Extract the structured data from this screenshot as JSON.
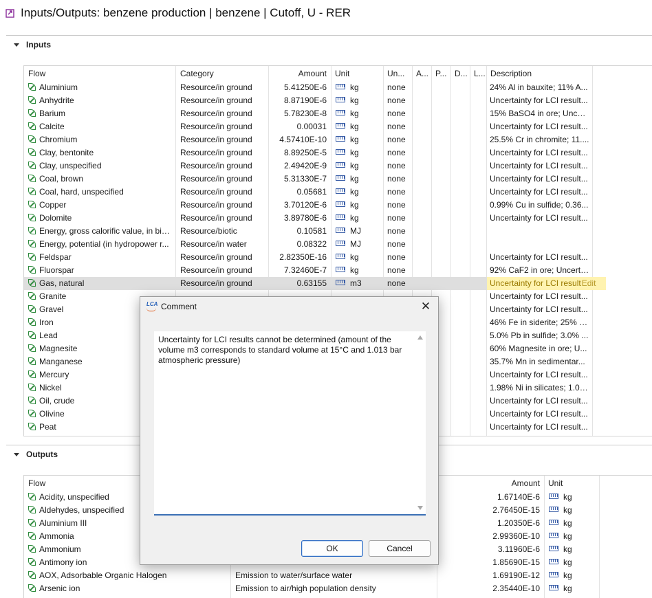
{
  "window": {
    "title": "Inputs/Outputs: benzene production | benzene | Cutoff, U - RER"
  },
  "inputs": {
    "section_label": "Inputs",
    "columns": {
      "flow": "Flow",
      "category": "Category",
      "amount": "Amount",
      "unit": "Unit",
      "uncertainty": "Un...",
      "avoided": "A...",
      "provider": "P...",
      "dq": "D...",
      "location": "L...",
      "description": "Description"
    },
    "rows": [
      {
        "flow": "Aluminium",
        "category": "Resource/in ground",
        "amount": "5.41250E-6",
        "unit": "kg",
        "uncertainty": "none",
        "description": "24% Al in bauxite; 11% A..."
      },
      {
        "flow": "Anhydrite",
        "category": "Resource/in ground",
        "amount": "8.87190E-6",
        "unit": "kg",
        "uncertainty": "none",
        "description": "Uncertainty for LCI result..."
      },
      {
        "flow": "Barium",
        "category": "Resource/in ground",
        "amount": "5.78230E-8",
        "unit": "kg",
        "uncertainty": "none",
        "description": "15% BaSO4 in ore; Uncer..."
      },
      {
        "flow": "Calcite",
        "category": "Resource/in ground",
        "amount": "0.00031",
        "unit": "kg",
        "uncertainty": "none",
        "description": "Uncertainty for LCI result..."
      },
      {
        "flow": "Chromium",
        "category": "Resource/in ground",
        "amount": "4.57410E-10",
        "unit": "kg",
        "uncertainty": "none",
        "description": "25.5% Cr in chromite; 11...."
      },
      {
        "flow": "Clay, bentonite",
        "category": "Resource/in ground",
        "amount": "8.89250E-5",
        "unit": "kg",
        "uncertainty": "none",
        "description": "Uncertainty for LCI result..."
      },
      {
        "flow": "Clay, unspecified",
        "category": "Resource/in ground",
        "amount": "2.49420E-9",
        "unit": "kg",
        "uncertainty": "none",
        "description": "Uncertainty for LCI result..."
      },
      {
        "flow": "Coal, brown",
        "category": "Resource/in ground",
        "amount": "5.31330E-7",
        "unit": "kg",
        "uncertainty": "none",
        "description": "Uncertainty for LCI result..."
      },
      {
        "flow": "Coal, hard, unspecified",
        "category": "Resource/in ground",
        "amount": "0.05681",
        "unit": "kg",
        "uncertainty": "none",
        "description": "Uncertainty for LCI result..."
      },
      {
        "flow": "Copper",
        "category": "Resource/in ground",
        "amount": "3.70120E-6",
        "unit": "kg",
        "uncertainty": "none",
        "description": "0.99% Cu in sulfide; 0.36..."
      },
      {
        "flow": "Dolomite",
        "category": "Resource/in ground",
        "amount": "3.89780E-6",
        "unit": "kg",
        "uncertainty": "none",
        "description": "Uncertainty for LCI result..."
      },
      {
        "flow": "Energy, gross calorific value, in bio...",
        "category": "Resource/biotic",
        "amount": "0.10581",
        "unit": "MJ",
        "uncertainty": "none",
        "description": ""
      },
      {
        "flow": "Energy, potential (in hydropower r...",
        "category": "Resource/in water",
        "amount": "0.08322",
        "unit": "MJ",
        "uncertainty": "none",
        "description": ""
      },
      {
        "flow": "Feldspar",
        "category": "Resource/in ground",
        "amount": "2.82350E-16",
        "unit": "kg",
        "uncertainty": "none",
        "description": "Uncertainty for LCI result..."
      },
      {
        "flow": "Fluorspar",
        "category": "Resource/in ground",
        "amount": "7.32460E-7",
        "unit": "kg",
        "uncertainty": "none",
        "description": "92% CaF2 in ore; Uncerta..."
      },
      {
        "flow": "Gas, natural",
        "category": "Resource/in ground",
        "amount": "0.63155",
        "unit": "m3",
        "uncertainty": "none",
        "description": "Uncertainty for LCI result",
        "edit": "Edit",
        "selected": true
      },
      {
        "flow": "Granite",
        "category": "",
        "amount": "",
        "unit": "",
        "uncertainty": "",
        "description": "Uncertainty for LCI result..."
      },
      {
        "flow": "Gravel",
        "category": "",
        "amount": "",
        "unit": "",
        "uncertainty": "",
        "description": "Uncertainty for LCI result..."
      },
      {
        "flow": "Iron",
        "category": "",
        "amount": "",
        "unit": "",
        "uncertainty": "",
        "description": "46% Fe in siderite; 25% F..."
      },
      {
        "flow": "Lead",
        "category": "",
        "amount": "",
        "unit": "",
        "uncertainty": "",
        "description": "5.0% Pb in sulfide; 3.0% ..."
      },
      {
        "flow": "Magnesite",
        "category": "",
        "amount": "",
        "unit": "",
        "uncertainty": "",
        "description": "60% Magnesite in ore; U..."
      },
      {
        "flow": "Manganese",
        "category": "",
        "amount": "",
        "unit": "",
        "uncertainty": "",
        "description": "35.7% Mn in sedimentar..."
      },
      {
        "flow": "Mercury",
        "category": "",
        "amount": "",
        "unit": "",
        "uncertainty": "",
        "description": "Uncertainty for LCI result..."
      },
      {
        "flow": "Nickel",
        "category": "",
        "amount": "",
        "unit": "",
        "uncertainty": "",
        "description": "1.98% Ni in silicates; 1.04..."
      },
      {
        "flow": "Oil, crude",
        "category": "",
        "amount": "",
        "unit": "",
        "uncertainty": "",
        "description": "Uncertainty for LCI result..."
      },
      {
        "flow": "Olivine",
        "category": "",
        "amount": "",
        "unit": "",
        "uncertainty": "",
        "description": "Uncertainty for LCI result..."
      },
      {
        "flow": "Peat",
        "category": "",
        "amount": "",
        "unit": "",
        "uncertainty": "",
        "description": "Uncertainty for LCI result..."
      }
    ]
  },
  "outputs": {
    "section_label": "Outputs",
    "columns": {
      "flow": "Flow",
      "amount": "Amount",
      "unit": "Unit"
    },
    "rows": [
      {
        "flow": "Acidity, unspecified",
        "category": "",
        "amount": "1.67140E-6",
        "unit": "kg"
      },
      {
        "flow": "Aldehydes, unspecified",
        "category": "",
        "amount": "2.76450E-15",
        "unit": "kg"
      },
      {
        "flow": "Aluminium III",
        "category": "",
        "amount": "1.20350E-6",
        "unit": "kg"
      },
      {
        "flow": "Ammonia",
        "category": "",
        "amount": "2.99360E-10",
        "unit": "kg"
      },
      {
        "flow": "Ammonium",
        "category": "",
        "amount": "3.11960E-6",
        "unit": "kg"
      },
      {
        "flow": "Antimony ion",
        "category": "",
        "amount": "1.85690E-15",
        "unit": "kg"
      },
      {
        "flow": "AOX, Adsorbable Organic Halogen",
        "category": "Emission to water/surface water",
        "amount": "1.69190E-12",
        "unit": "kg"
      },
      {
        "flow": "Arsenic ion",
        "category": "Emission to air/high population density",
        "amount": "2.35440E-10",
        "unit": "kg"
      }
    ]
  },
  "dialog": {
    "title": "Comment",
    "text": "Uncertainty for LCI results cannot be determined (amount of the volume m3 corresponds to standard volume at 15°C and 1.013 bar atmospheric pressure)",
    "ok": "OK",
    "cancel": "Cancel",
    "close_glyph": "✕",
    "logo": "LCA"
  }
}
